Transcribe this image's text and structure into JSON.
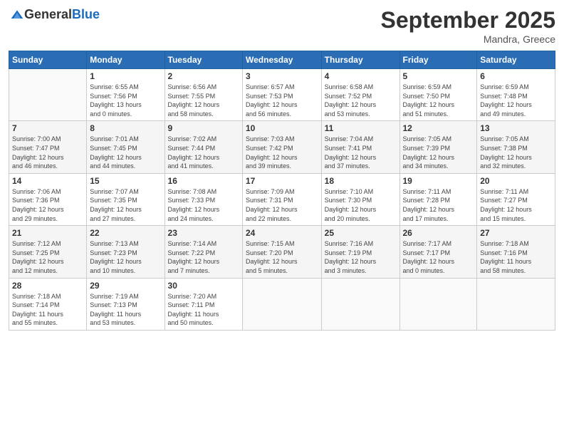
{
  "header": {
    "logo_general": "General",
    "logo_blue": "Blue",
    "month_title": "September 2025",
    "subtitle": "Mandra, Greece"
  },
  "weekdays": [
    "Sunday",
    "Monday",
    "Tuesday",
    "Wednesday",
    "Thursday",
    "Friday",
    "Saturday"
  ],
  "weeks": [
    [
      {
        "day": "",
        "info": ""
      },
      {
        "day": "1",
        "info": "Sunrise: 6:55 AM\nSunset: 7:56 PM\nDaylight: 13 hours\nand 0 minutes."
      },
      {
        "day": "2",
        "info": "Sunrise: 6:56 AM\nSunset: 7:55 PM\nDaylight: 12 hours\nand 58 minutes."
      },
      {
        "day": "3",
        "info": "Sunrise: 6:57 AM\nSunset: 7:53 PM\nDaylight: 12 hours\nand 56 minutes."
      },
      {
        "day": "4",
        "info": "Sunrise: 6:58 AM\nSunset: 7:52 PM\nDaylight: 12 hours\nand 53 minutes."
      },
      {
        "day": "5",
        "info": "Sunrise: 6:59 AM\nSunset: 7:50 PM\nDaylight: 12 hours\nand 51 minutes."
      },
      {
        "day": "6",
        "info": "Sunrise: 6:59 AM\nSunset: 7:48 PM\nDaylight: 12 hours\nand 49 minutes."
      }
    ],
    [
      {
        "day": "7",
        "info": "Sunrise: 7:00 AM\nSunset: 7:47 PM\nDaylight: 12 hours\nand 46 minutes."
      },
      {
        "day": "8",
        "info": "Sunrise: 7:01 AM\nSunset: 7:45 PM\nDaylight: 12 hours\nand 44 minutes."
      },
      {
        "day": "9",
        "info": "Sunrise: 7:02 AM\nSunset: 7:44 PM\nDaylight: 12 hours\nand 41 minutes."
      },
      {
        "day": "10",
        "info": "Sunrise: 7:03 AM\nSunset: 7:42 PM\nDaylight: 12 hours\nand 39 minutes."
      },
      {
        "day": "11",
        "info": "Sunrise: 7:04 AM\nSunset: 7:41 PM\nDaylight: 12 hours\nand 37 minutes."
      },
      {
        "day": "12",
        "info": "Sunrise: 7:05 AM\nSunset: 7:39 PM\nDaylight: 12 hours\nand 34 minutes."
      },
      {
        "day": "13",
        "info": "Sunrise: 7:05 AM\nSunset: 7:38 PM\nDaylight: 12 hours\nand 32 minutes."
      }
    ],
    [
      {
        "day": "14",
        "info": "Sunrise: 7:06 AM\nSunset: 7:36 PM\nDaylight: 12 hours\nand 29 minutes."
      },
      {
        "day": "15",
        "info": "Sunrise: 7:07 AM\nSunset: 7:35 PM\nDaylight: 12 hours\nand 27 minutes."
      },
      {
        "day": "16",
        "info": "Sunrise: 7:08 AM\nSunset: 7:33 PM\nDaylight: 12 hours\nand 24 minutes."
      },
      {
        "day": "17",
        "info": "Sunrise: 7:09 AM\nSunset: 7:31 PM\nDaylight: 12 hours\nand 22 minutes."
      },
      {
        "day": "18",
        "info": "Sunrise: 7:10 AM\nSunset: 7:30 PM\nDaylight: 12 hours\nand 20 minutes."
      },
      {
        "day": "19",
        "info": "Sunrise: 7:11 AM\nSunset: 7:28 PM\nDaylight: 12 hours\nand 17 minutes."
      },
      {
        "day": "20",
        "info": "Sunrise: 7:11 AM\nSunset: 7:27 PM\nDaylight: 12 hours\nand 15 minutes."
      }
    ],
    [
      {
        "day": "21",
        "info": "Sunrise: 7:12 AM\nSunset: 7:25 PM\nDaylight: 12 hours\nand 12 minutes."
      },
      {
        "day": "22",
        "info": "Sunrise: 7:13 AM\nSunset: 7:23 PM\nDaylight: 12 hours\nand 10 minutes."
      },
      {
        "day": "23",
        "info": "Sunrise: 7:14 AM\nSunset: 7:22 PM\nDaylight: 12 hours\nand 7 minutes."
      },
      {
        "day": "24",
        "info": "Sunrise: 7:15 AM\nSunset: 7:20 PM\nDaylight: 12 hours\nand 5 minutes."
      },
      {
        "day": "25",
        "info": "Sunrise: 7:16 AM\nSunset: 7:19 PM\nDaylight: 12 hours\nand 3 minutes."
      },
      {
        "day": "26",
        "info": "Sunrise: 7:17 AM\nSunset: 7:17 PM\nDaylight: 12 hours\nand 0 minutes."
      },
      {
        "day": "27",
        "info": "Sunrise: 7:18 AM\nSunset: 7:16 PM\nDaylight: 11 hours\nand 58 minutes."
      }
    ],
    [
      {
        "day": "28",
        "info": "Sunrise: 7:18 AM\nSunset: 7:14 PM\nDaylight: 11 hours\nand 55 minutes."
      },
      {
        "day": "29",
        "info": "Sunrise: 7:19 AM\nSunset: 7:13 PM\nDaylight: 11 hours\nand 53 minutes."
      },
      {
        "day": "30",
        "info": "Sunrise: 7:20 AM\nSunset: 7:11 PM\nDaylight: 11 hours\nand 50 minutes."
      },
      {
        "day": "",
        "info": ""
      },
      {
        "day": "",
        "info": ""
      },
      {
        "day": "",
        "info": ""
      },
      {
        "day": "",
        "info": ""
      }
    ]
  ]
}
